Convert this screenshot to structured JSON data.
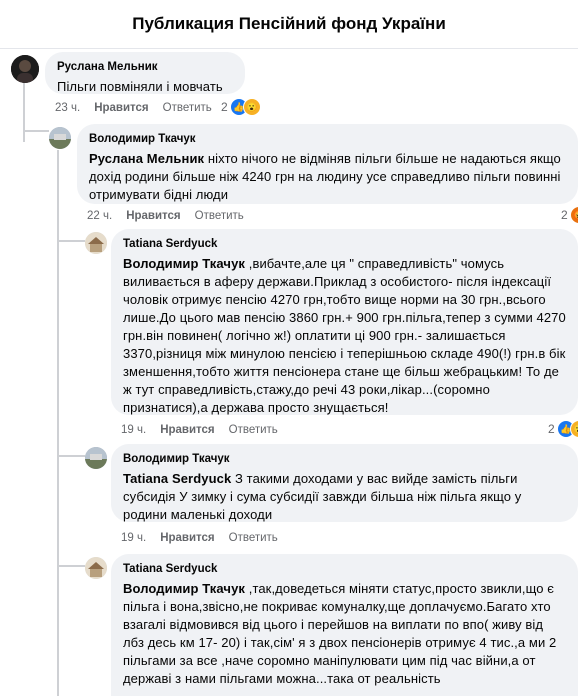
{
  "header": {
    "title": "Публикация Пенсійний фонд України"
  },
  "icons": {
    "like": "like-icon",
    "wow": "wow-icon",
    "angry": "angry-icon"
  },
  "colors": {
    "bubble": "#f0f2f5",
    "like_blue": "#1877f2",
    "muted": "#65676b"
  },
  "comments": [
    {
      "author": "Руслана Мельник",
      "mention": "",
      "text": "Пільги повміняли і мовчать",
      "time": "23 ч.",
      "like": "Нравится",
      "reply": "Ответить",
      "reactions": "2"
    },
    {
      "author": "Володимир Ткачук",
      "mention": "Руслана Мельник",
      "text": " ніхто нічого не відміняв пільги більше не надаються якщо дохід родини більше ніж 4240 грн на людину усе справедливо пільги повинні отримувати бідні люди",
      "time": "22 ч.",
      "like": "Нравится",
      "reply": "Ответить",
      "reactions": "2"
    },
    {
      "author": "Tatiana Serdyuck",
      "mention": "Володимир Ткачук",
      "text": " ,вибачте,але ця \" справедливість\" чомусь виливається в аферу держави.Приклад з особистого- після індексації чоловік отримує пенсію 4270 грн,тобто вище норми на 30 грн.,всього лише.До цього мав пенсію 3860 грн.+ 900 грн.пільга,тепер з сумми 4270 грн.він повинен( логічно ж!) оплатити ці 900 грн.- залишається 3370,різниця між минулою пенсією і теперішньою складе 490(!) грн.в бік зменшення,тобто життя пенсіонера стане ще більш жебрацьким! То де ж тут справедливість,стажу,до речі 43 роки,лікар...(соромно признатися),а держава просто знущається!",
      "time": "19 ч.",
      "like": "Нравится",
      "reply": "Ответить",
      "reactions": "2"
    },
    {
      "author": "Володимир Ткачук",
      "mention": "Tatiana Serdyuck",
      "text": " З такими доходами у вас вийде замість пільги субсидія У зимку і сума субсидії завжди більша ніж пільга якщо у родини маленькі доходи",
      "time": "19 ч.",
      "like": "Нравится",
      "reply": "Ответить",
      "reactions": ""
    },
    {
      "author": "Tatiana Serdyuck",
      "mention": "Володимир Ткачук",
      "text": " ,так,доведеться міняти статус,просто звикли,що є пільга і вона,звісно,не покриває комуналку,ще доплачуємо.Багато хто взагалі відмовився від цього і перейшов на виплати по впо( живу від лбз десь км 17- 20) і так,сім' я з двох пенсіонерів отримує 4 тис.,а ми 2 пільгами за все ,наче соромно маніпулювати цим під час війни,а от державі з нами пільгами можна...така от реальність",
      "time": "",
      "like": "",
      "reply": "",
      "reactions": ""
    }
  ]
}
